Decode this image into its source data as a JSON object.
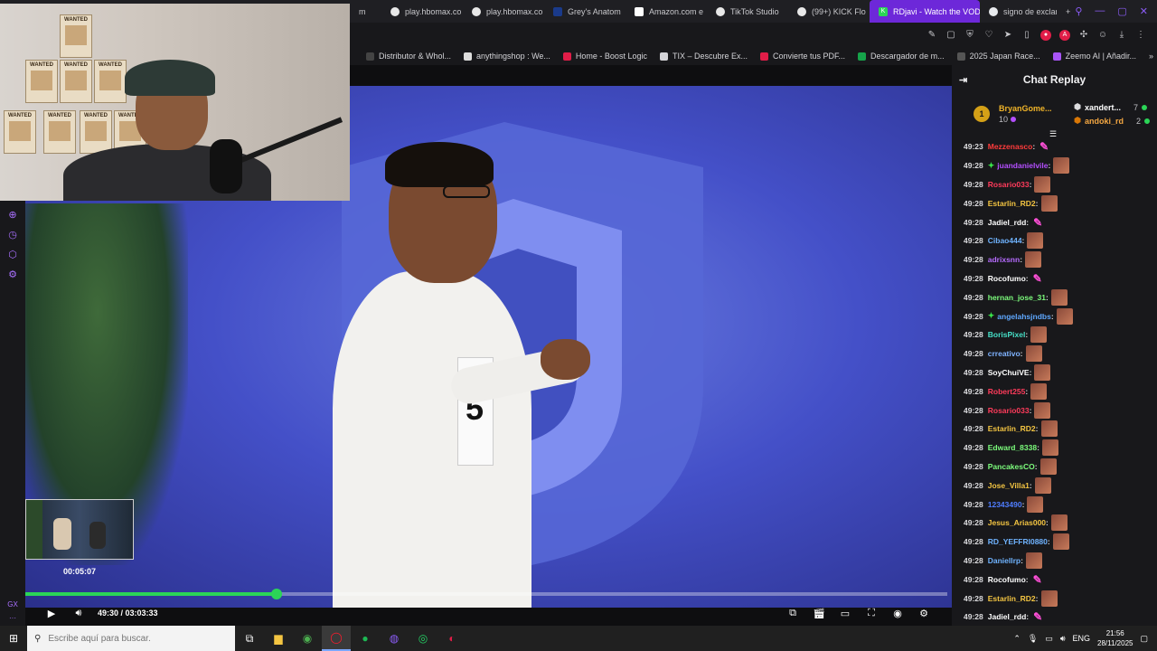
{
  "browser": {
    "tabs": [
      {
        "label": "m",
        "icon": "tab-icon"
      },
      {
        "label": "play.hbomax.co",
        "icon": "hbomax-icon"
      },
      {
        "label": "play.hbomax.co",
        "icon": "hbomax-icon"
      },
      {
        "label": "Grey's Anatom",
        "icon": "disney-icon"
      },
      {
        "label": "Amazon.com e",
        "icon": "amazon-icon"
      },
      {
        "label": "TikTok Studio",
        "icon": "tiktok-icon"
      },
      {
        "label": "(99+) KICK Flo",
        "icon": "tiktok-icon"
      },
      {
        "label": "RDjavi - Watch the VOD o",
        "icon": "kick-icon"
      },
      {
        "label": "signo de exclan",
        "icon": "google-icon"
      }
    ],
    "new_tab": "+",
    "bookmarks": [
      {
        "label": "Distributor & Whol..."
      },
      {
        "label": "anythingshop : We..."
      },
      {
        "label": "Home - Boost Logic"
      },
      {
        "label": "TIX – Descubre Ex..."
      },
      {
        "label": "Convierte tus PDF..."
      },
      {
        "label": "Descargador de m..."
      },
      {
        "label": "2025 Japan Race..."
      },
      {
        "label": "Zeemo AI | Añadir..."
      }
    ],
    "accent": "#6d28d9"
  },
  "player": {
    "thumb_time": "00:05:07",
    "time_readout": "49:30 / 03:03:33",
    "progress": 0.273,
    "progress_color": "#2bd557"
  },
  "chat": {
    "title": "Chat Replay",
    "leaderboard": {
      "first": {
        "rank": "1",
        "name": "BryanGome...",
        "points": "10"
      },
      "second": {
        "name": "xandert...",
        "points": "7"
      },
      "third": {
        "name": "andoki_rd",
        "points": "2"
      }
    },
    "messages": [
      {
        "ts": "49:23",
        "user": "Mezzenasco",
        "color": "#ff3b3b",
        "emote": "pink",
        "badge": false
      },
      {
        "ts": "49:28",
        "user": "juandanielvile",
        "color": "#b44fff",
        "emote": "img",
        "badge": true
      },
      {
        "ts": "49:28",
        "user": "Rosario033",
        "color": "#ff3b5b",
        "emote": "img",
        "badge": false
      },
      {
        "ts": "49:28",
        "user": "Estarlin_RD2",
        "color": "#f4c542",
        "emote": "img",
        "badge": false
      },
      {
        "ts": "49:28",
        "user": "Jadiel_rdd",
        "color": "#ffffff",
        "emote": "pink",
        "badge": false
      },
      {
        "ts": "49:28",
        "user": "Cibao444",
        "color": "#6fb3ff",
        "emote": "img",
        "badge": false
      },
      {
        "ts": "49:28",
        "user": "adrixsnn",
        "color": "#b66bff",
        "emote": "img",
        "badge": false
      },
      {
        "ts": "49:28",
        "user": "Rocofumo",
        "color": "#ffffff",
        "emote": "pink",
        "badge": false
      },
      {
        "ts": "49:28",
        "user": "hernan_jose_31",
        "color": "#7cfc7c",
        "emote": "img",
        "badge": false
      },
      {
        "ts": "49:28",
        "user": "angelahsjndbs",
        "color": "#5fa8ff",
        "emote": "img",
        "badge": true
      },
      {
        "ts": "49:28",
        "user": "BorisPixel",
        "color": "#46e0c8",
        "emote": "img",
        "badge": false
      },
      {
        "ts": "49:28",
        "user": "crreativo",
        "color": "#7fb3ff",
        "emote": "img",
        "badge": false
      },
      {
        "ts": "49:28",
        "user": "SoyChuiVE",
        "color": "#ffffff",
        "emote": "img",
        "badge": false
      },
      {
        "ts": "49:28",
        "user": "Robert255",
        "color": "#ff3b5b",
        "emote": "img",
        "badge": false
      },
      {
        "ts": "49:28",
        "user": "Rosario033",
        "color": "#ff3b5b",
        "emote": "img",
        "badge": false
      },
      {
        "ts": "49:28",
        "user": "Estarlin_RD2",
        "color": "#f4c542",
        "emote": "img",
        "badge": false
      },
      {
        "ts": "49:28",
        "user": "Edward_8338",
        "color": "#7cfc7c",
        "emote": "img",
        "badge": false
      },
      {
        "ts": "49:28",
        "user": "PancakesCO",
        "color": "#7cfc7c",
        "emote": "img",
        "badge": false
      },
      {
        "ts": "49:28",
        "user": "Jose_Villa1",
        "color": "#f4c542",
        "emote": "img",
        "badge": false
      },
      {
        "ts": "49:28",
        "user": "12343490",
        "color": "#4f7dff",
        "emote": "img",
        "badge": false
      },
      {
        "ts": "49:28",
        "user": "Jesus_Arias000",
        "color": "#f4c542",
        "emote": "img",
        "badge": false
      },
      {
        "ts": "49:28",
        "user": "RD_YEFFRI0880",
        "color": "#6fb3ff",
        "emote": "img",
        "badge": false
      },
      {
        "ts": "49:28",
        "user": "Daniellrp",
        "color": "#6fb3ff",
        "emote": "img",
        "badge": false
      },
      {
        "ts": "49:28",
        "user": "Rocofumo",
        "color": "#ffffff",
        "emote": "pink",
        "badge": false
      },
      {
        "ts": "49:28",
        "user": "Estarlin_RD2",
        "color": "#f4c542",
        "emote": "img",
        "badge": false
      },
      {
        "ts": "49:28",
        "user": "Jadiel_rdd",
        "color": "#ffffff",
        "emote": "pink",
        "badge": false
      }
    ]
  },
  "taskbar": {
    "search_placeholder": "Escribe aquí para buscar.",
    "lang": "ENG",
    "time": "21:56",
    "date": "28/11/2025"
  },
  "sidebar": {
    "bottom_label": "GX"
  }
}
